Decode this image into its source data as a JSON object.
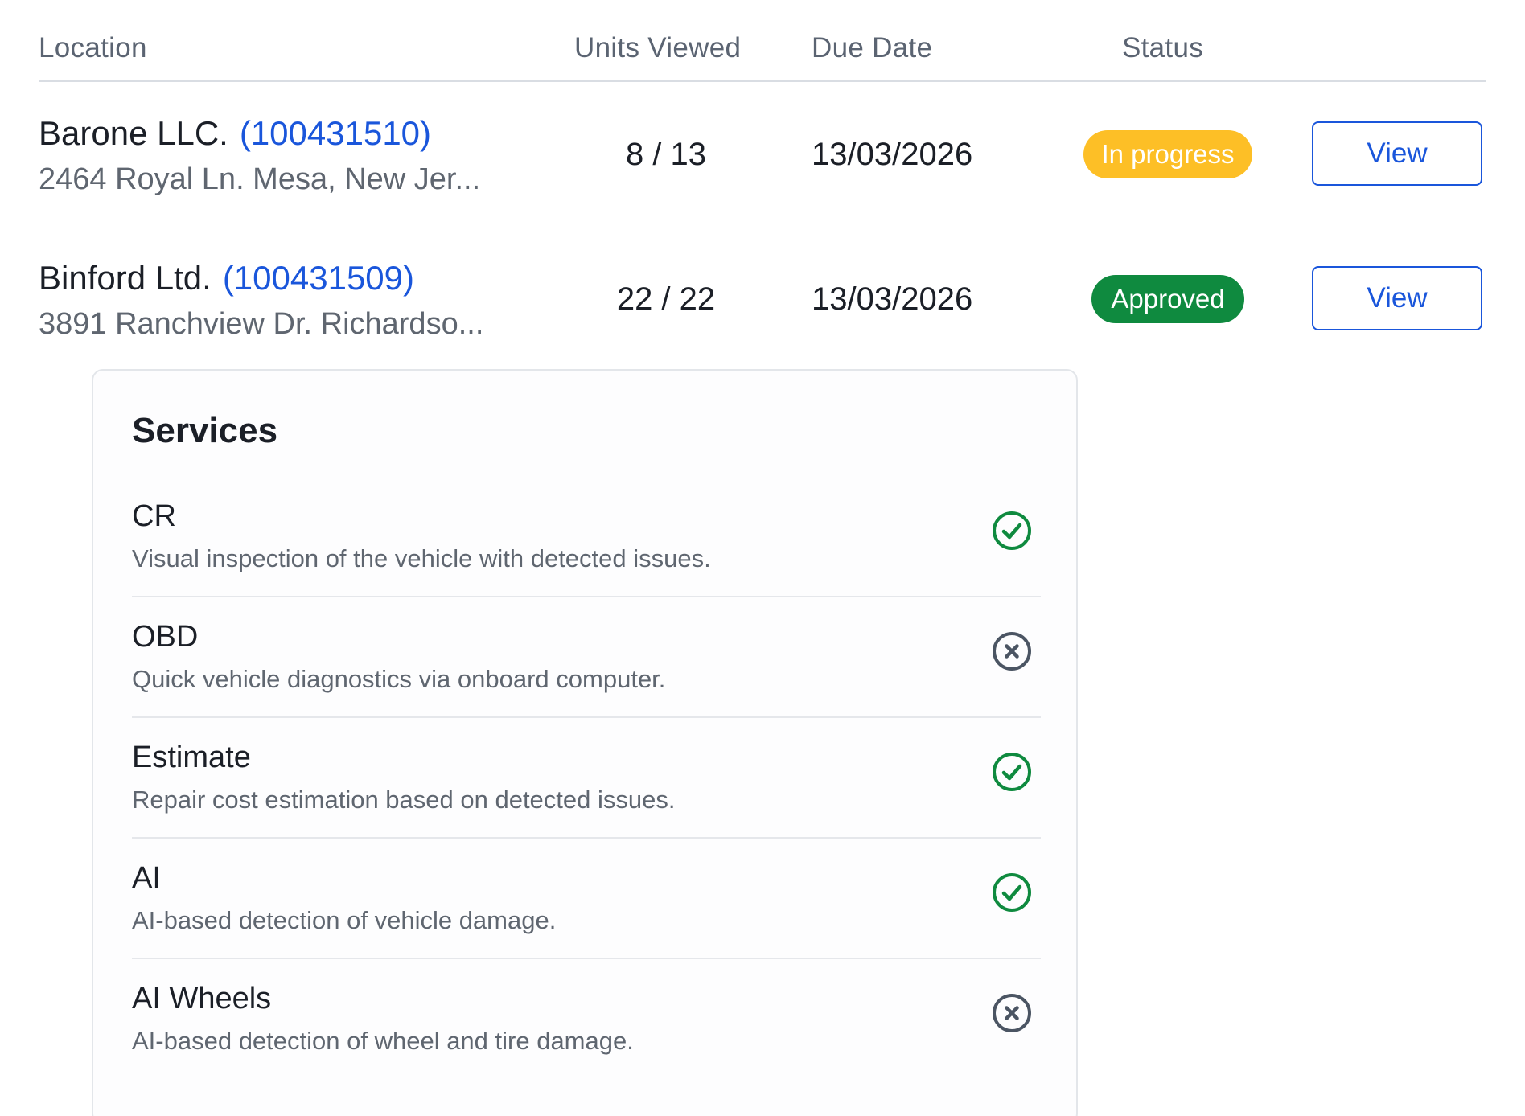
{
  "table": {
    "headers": {
      "location": "Location",
      "units_viewed": "Units Viewed",
      "due_date": "Due Date",
      "status": "Status"
    },
    "rows": [
      {
        "name": "Barone LLC.",
        "id": "(100431510)",
        "address": "2464 Royal Ln. Mesa, New Jer...",
        "units": "8 / 13",
        "due_date": "13/03/2026",
        "status": "In progress",
        "status_color": "#fdbf26",
        "action": "View"
      },
      {
        "name": "Binford Ltd.",
        "id": "(100431509)",
        "address": "3891 Ranchview Dr. Richardso...",
        "units": "22 / 22",
        "due_date": "13/03/2026",
        "status": "Approved",
        "status_color": "#0f8a3f",
        "action": "View"
      }
    ]
  },
  "services": {
    "title": "Services",
    "items": [
      {
        "name": "CR",
        "description": "Visual inspection of the vehicle with detected issues.",
        "enabled": true,
        "icon": "check-circle-icon"
      },
      {
        "name": "OBD",
        "description": "Quick vehicle diagnostics via onboard computer.",
        "enabled": false,
        "icon": "x-circle-icon"
      },
      {
        "name": "Estimate",
        "description": "Repair cost estimation based on detected issues.",
        "enabled": true,
        "icon": "check-circle-icon"
      },
      {
        "name": "AI",
        "description": "AI-based detection of vehicle damage.",
        "enabled": true,
        "icon": "check-circle-icon"
      },
      {
        "name": "AI Wheels",
        "description": "AI-based detection of wheel and tire damage.",
        "enabled": false,
        "icon": "x-circle-icon"
      }
    ]
  },
  "colors": {
    "link_blue": "#1a56db",
    "check_green": "#0f8a3f",
    "x_gray": "#4b5563"
  }
}
